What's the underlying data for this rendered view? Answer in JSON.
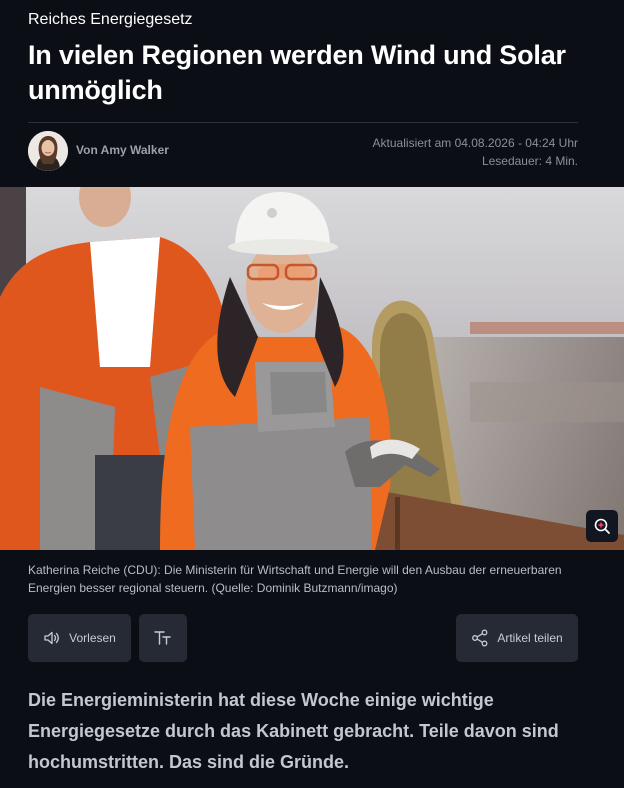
{
  "article": {
    "kicker": "Reiches Energiegesetz",
    "headline": "In vielen Regionen werden Wind und Solar unmöglich",
    "author": "Von Amy Walker",
    "updated": "Aktualisiert am 04.08.2026 - 04:24 Uhr",
    "reading_time": "Lesedauer: 4 Min.",
    "image_caption": "Katherina Reiche (CDU): Die Ministerin für Wirtschaft und Energie will den Ausbau der erneuerbaren Energien besser regional steuern. (Quelle: Dominik Butzmann/imago)",
    "lead": "Die Energieministerin hat diese Woche einige wichtige Energiegesetze durch das Kabinett gebracht. Teile davon sind hochumstritten. Das sind die Gründe."
  },
  "toolbar": {
    "read_aloud_label": "Vorlesen",
    "share_label": "Artikel teilen"
  },
  "icons": {
    "zoom": "zoom-in-icon",
    "speaker": "speaker-icon",
    "text_size": "text-size-icon",
    "share": "share-icon"
  }
}
